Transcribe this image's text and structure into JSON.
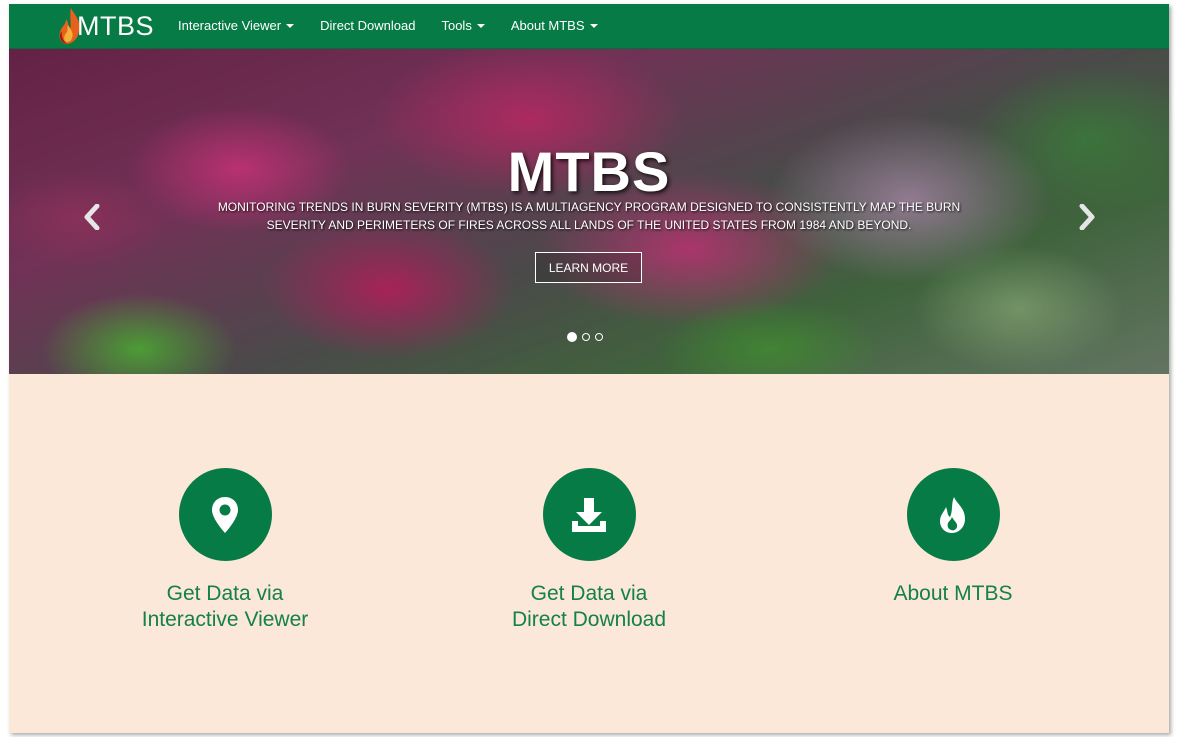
{
  "navbar": {
    "brand": "MTBS",
    "items": [
      {
        "label": "Interactive Viewer",
        "dropdown": true
      },
      {
        "label": "Direct Download",
        "dropdown": false
      },
      {
        "label": "Tools",
        "dropdown": true
      },
      {
        "label": "About MTBS",
        "dropdown": true
      }
    ],
    "background_color": "#067b45"
  },
  "carousel": {
    "title": "MTBS",
    "description": "Monitoring Trends in Burn Severity (MTBS) is a multiagency program designed to consistently map the burn severity and perimeters of fires across all lands of the United States from 1984 and beyond.",
    "button_label": "LEARN MORE",
    "slide_count": 3,
    "active_slide": 1
  },
  "features": [
    {
      "line1": "Get Data via",
      "line2": "Interactive Viewer",
      "icon": "map-marker-icon"
    },
    {
      "line1": "Get Data via",
      "line2": "Direct Download",
      "icon": "download-icon"
    },
    {
      "line1": "About MTBS",
      "line2": "",
      "icon": "fire-icon"
    }
  ],
  "colors": {
    "accent": "#067b45",
    "feature_text": "#14804a",
    "page_background": "#fbe8d9"
  }
}
